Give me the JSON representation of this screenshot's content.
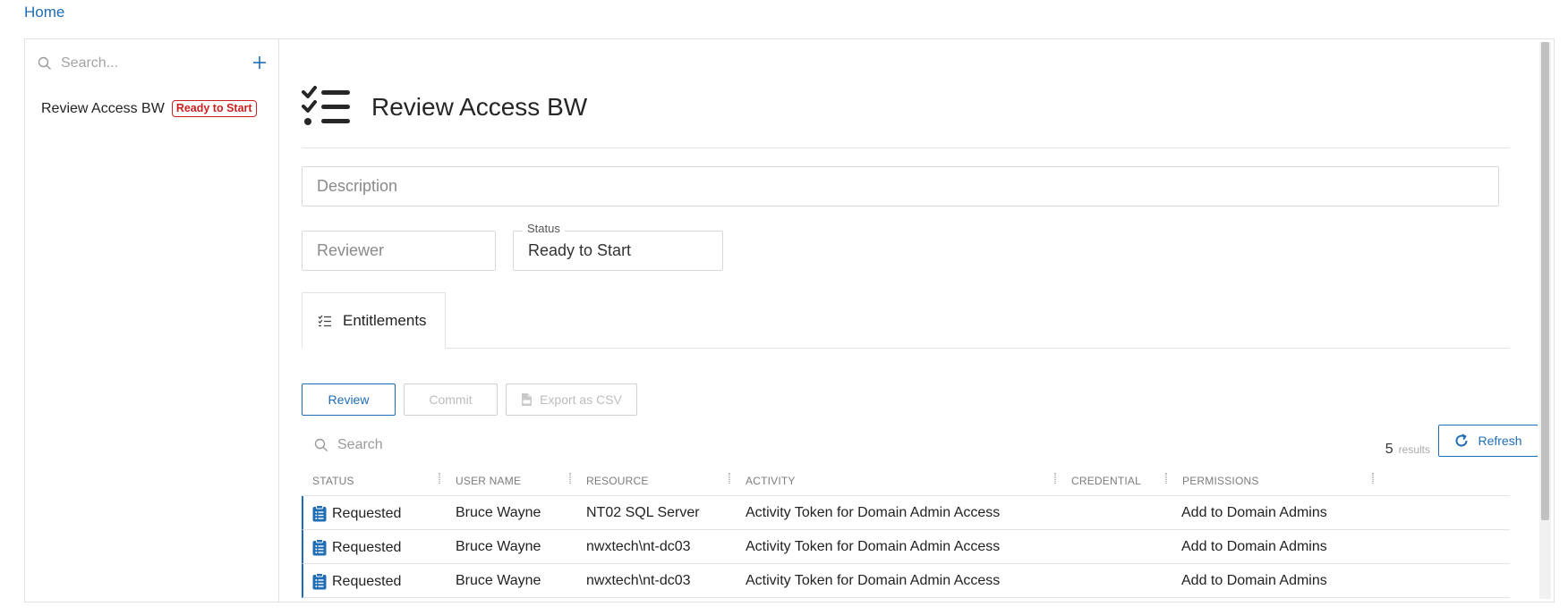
{
  "breadcrumb": {
    "home": "Home"
  },
  "sidebar": {
    "search_placeholder": "Search...",
    "items": [
      {
        "label": "Review Access BW",
        "badge": "Ready to Start"
      }
    ]
  },
  "main": {
    "title": "Review Access BW",
    "description_placeholder": "Description",
    "reviewer_placeholder": "Reviewer",
    "status_legend": "Status",
    "status_value": "Ready to Start",
    "tabs": [
      {
        "label": "Entitlements"
      }
    ],
    "buttons": {
      "review": "Review",
      "commit": "Commit",
      "export": "Export as CSV",
      "refresh": "Refresh"
    },
    "grid": {
      "search_placeholder": "Search",
      "results_count": "5",
      "results_label": "results",
      "columns": [
        "STATUS",
        "USER NAME",
        "RESOURCE",
        "ACTIVITY",
        "CREDENTIAL",
        "PERMISSIONS"
      ],
      "rows": [
        {
          "status": "Requested",
          "user": "Bruce Wayne",
          "resource": "NT02 SQL Server",
          "activity": "Activity Token for Domain Admin Access",
          "credential": "",
          "permissions": "Add to Domain Admins"
        },
        {
          "status": "Requested",
          "user": "Bruce Wayne",
          "resource": "nwxtech\\nt-dc03",
          "activity": "Activity Token for Domain Admin Access",
          "credential": "",
          "permissions": "Add to Domain Admins"
        },
        {
          "status": "Requested",
          "user": "Bruce Wayne",
          "resource": "nwxtech\\nt-dc03",
          "activity": "Activity Token for Domain Admin Access",
          "credential": "",
          "permissions": "Add to Domain Admins"
        }
      ]
    }
  },
  "colors": {
    "accent": "#1f6db5",
    "badge_red": "#cc1f1f",
    "border": "#e2e2e2"
  },
  "icons": [
    "search-icon",
    "plus-icon",
    "checklist-icon",
    "list-check-icon",
    "csv-file-icon",
    "refresh-icon",
    "clipboard-list-icon"
  ]
}
